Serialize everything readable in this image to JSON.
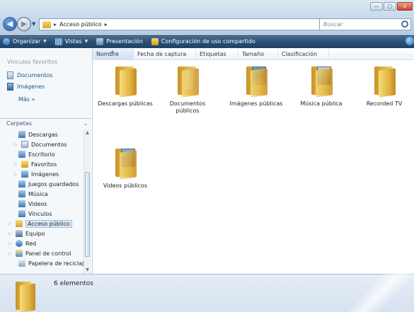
{
  "window": {
    "minimize_glyph": "—",
    "maximize_glyph": "□",
    "close_glyph": "x"
  },
  "address": {
    "crumb": "Acceso público",
    "sep1": "▸",
    "sep2": "▸"
  },
  "search": {
    "placeholder": "Buscar"
  },
  "toolbar": {
    "organize": "Organizar",
    "views": "Vistas",
    "presentation": "Presentación",
    "share_settings": "Configuración de uso compartido"
  },
  "nav": {
    "favorites_title": "Vínculos favoritos",
    "favorites": [
      {
        "label": "Documentos",
        "icon": "documents-icon"
      },
      {
        "label": "Imágenes",
        "icon": "pictures-icon"
      }
    ],
    "more": "Más »",
    "folders_title": "Carpetas",
    "tree": [
      {
        "label": "Descargas",
        "icon": "downloads-folder-icon",
        "expandable": false
      },
      {
        "label": "Documentos",
        "icon": "documents-folder-icon",
        "expandable": true
      },
      {
        "label": "Escritorio",
        "icon": "desktop-folder-icon",
        "expandable": false
      },
      {
        "label": "Favoritos",
        "icon": "favorites-folder-icon",
        "expandable": true
      },
      {
        "label": "Imágenes",
        "icon": "pictures-folder-icon",
        "expandable": true
      },
      {
        "label": "Juegos guardados",
        "icon": "saved-games-folder-icon",
        "expandable": false
      },
      {
        "label": "Música",
        "icon": "music-folder-icon",
        "expandable": false
      },
      {
        "label": "Videos",
        "icon": "videos-folder-icon",
        "expandable": false
      },
      {
        "label": "Vínculos",
        "icon": "links-folder-icon",
        "expandable": false
      },
      {
        "label": "Acceso público",
        "icon": "public-folder-icon",
        "expandable": true,
        "selected": true
      },
      {
        "label": "Equipo",
        "icon": "computer-icon",
        "expandable": true
      },
      {
        "label": "Red",
        "icon": "network-icon",
        "expandable": true
      },
      {
        "label": "Panel de control",
        "icon": "control-panel-icon",
        "expandable": true
      },
      {
        "label": "Papelera de reciclaje",
        "icon": "recycle-bin-icon",
        "expandable": false
      }
    ]
  },
  "columns": [
    "Nombre",
    "Fecha de captura",
    "Etiquetas",
    "Tamaño",
    "Clasificación"
  ],
  "items": [
    {
      "label": "Descargas públicas",
      "icon": "public-downloads-folder-icon"
    },
    {
      "label": "Documentos públicos",
      "icon": "public-documents-folder-icon"
    },
    {
      "label": "Imágenes públicas",
      "icon": "public-pictures-folder-icon"
    },
    {
      "label": "Música pública",
      "icon": "public-music-folder-icon"
    },
    {
      "label": "Recorded TV",
      "icon": "recorded-tv-folder-icon"
    },
    {
      "label": "Videos públicos",
      "icon": "public-videos-folder-icon"
    }
  ],
  "details": {
    "count": "6 elementos"
  }
}
